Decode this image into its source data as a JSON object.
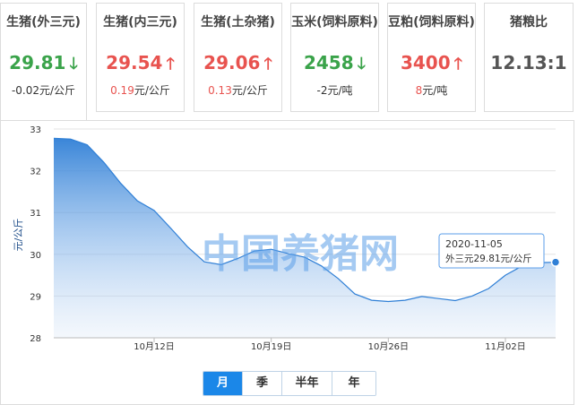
{
  "cards": [
    {
      "name": "生猪(外三元)",
      "price": "29.81",
      "direction": "down",
      "change": "-0.02",
      "unit": "元/公斤"
    },
    {
      "name": "生猪(内三元)",
      "price": "29.54",
      "direction": "up",
      "change": "0.19",
      "unit": "元/公斤"
    },
    {
      "name": "生猪(土杂猪)",
      "price": "29.06",
      "direction": "up",
      "change": "0.13",
      "unit": "元/公斤"
    },
    {
      "name": "玉米(饲料原料)",
      "price": "2458",
      "direction": "down",
      "change": "-2",
      "unit": "元/吨"
    },
    {
      "name": "豆粕(饲料原料)",
      "price": "3400",
      "direction": "up",
      "change": "8",
      "unit": "元/吨"
    },
    {
      "name": "猪粮比",
      "price": "12.13:1",
      "direction": "none",
      "change": "",
      "unit": ""
    }
  ],
  "watermark": "中国养猪网",
  "tooltip": {
    "date": "2020-11-05",
    "text": "外三元29.81元/公斤"
  },
  "periods": [
    "月",
    "季",
    "半年",
    "年"
  ],
  "selected_period": "月",
  "colors": {
    "up": "#e8534f",
    "down": "#3aa34a",
    "accent": "#1b87e8",
    "line": "#2f7fd6"
  },
  "chart_data": {
    "type": "area",
    "title": "",
    "xlabel": "",
    "ylabel": "元/公斤",
    "ylim": [
      28,
      33
    ],
    "yticks": [
      28,
      29,
      30,
      31,
      32,
      33
    ],
    "grid": true,
    "x_tick_labels": [
      "10月12日",
      "10月19日",
      "10月26日",
      "11月02日"
    ],
    "x_tick_days": [
      12,
      19,
      26,
      33
    ],
    "x_start_day": 6,
    "x_end_day": 36,
    "series": [
      {
        "name": "外三元",
        "x": [
          6,
          7,
          8,
          9,
          10,
          11,
          12,
          13,
          14,
          15,
          16,
          17,
          18,
          19,
          20,
          21,
          22,
          23,
          24,
          25,
          26,
          27,
          28,
          29,
          30,
          31,
          32,
          33,
          34,
          35,
          36
        ],
        "values": [
          32.78,
          32.76,
          32.62,
          32.2,
          31.7,
          31.28,
          31.05,
          30.62,
          30.18,
          29.82,
          29.75,
          29.9,
          30.08,
          30.12,
          30.02,
          29.93,
          29.72,
          29.42,
          29.05,
          28.9,
          28.87,
          28.9,
          28.99,
          28.94,
          28.89,
          29.0,
          29.18,
          29.5,
          29.72,
          29.8,
          29.81
        ]
      }
    ]
  }
}
